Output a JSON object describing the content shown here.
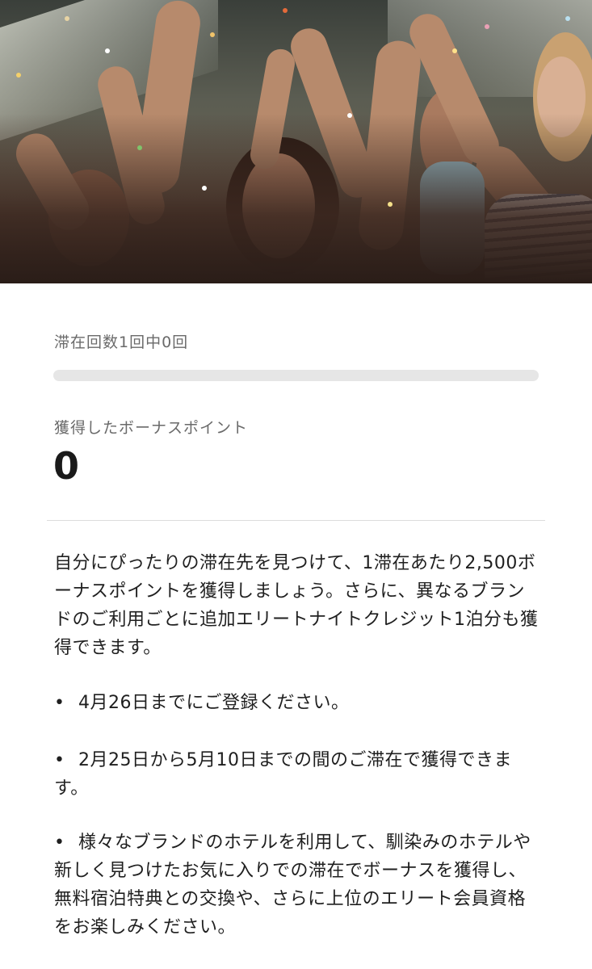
{
  "progress": {
    "stays_label": "滞在回数1回中0回",
    "stays_completed": 0,
    "stays_required": 1,
    "fill_fraction": 0
  },
  "bonus": {
    "label": "獲得したボーナスポイント",
    "value": "0"
  },
  "description": {
    "intro": "自分にぴったりの滞在先を見つけて、1滞在あたり2,500ボーナスポイントを獲得しましょう。さらに、異なるブランドのご利用ごとに追加エリートナイトクレジット1泊分も獲得できます。",
    "bullets": [
      "4月26日までにご登録ください。",
      "2月25日から5月10日までの間のご滞在で獲得できます。",
      "様々なブランドのホテルを利用して、馴染みのホテルや新しく見つけたお気に入りでの滞在でボーナスを獲得し、無料宿泊特典との交換や、さらに上位のエリート会員資格をお楽しみください。"
    ],
    "bullet_symbol": "•"
  }
}
